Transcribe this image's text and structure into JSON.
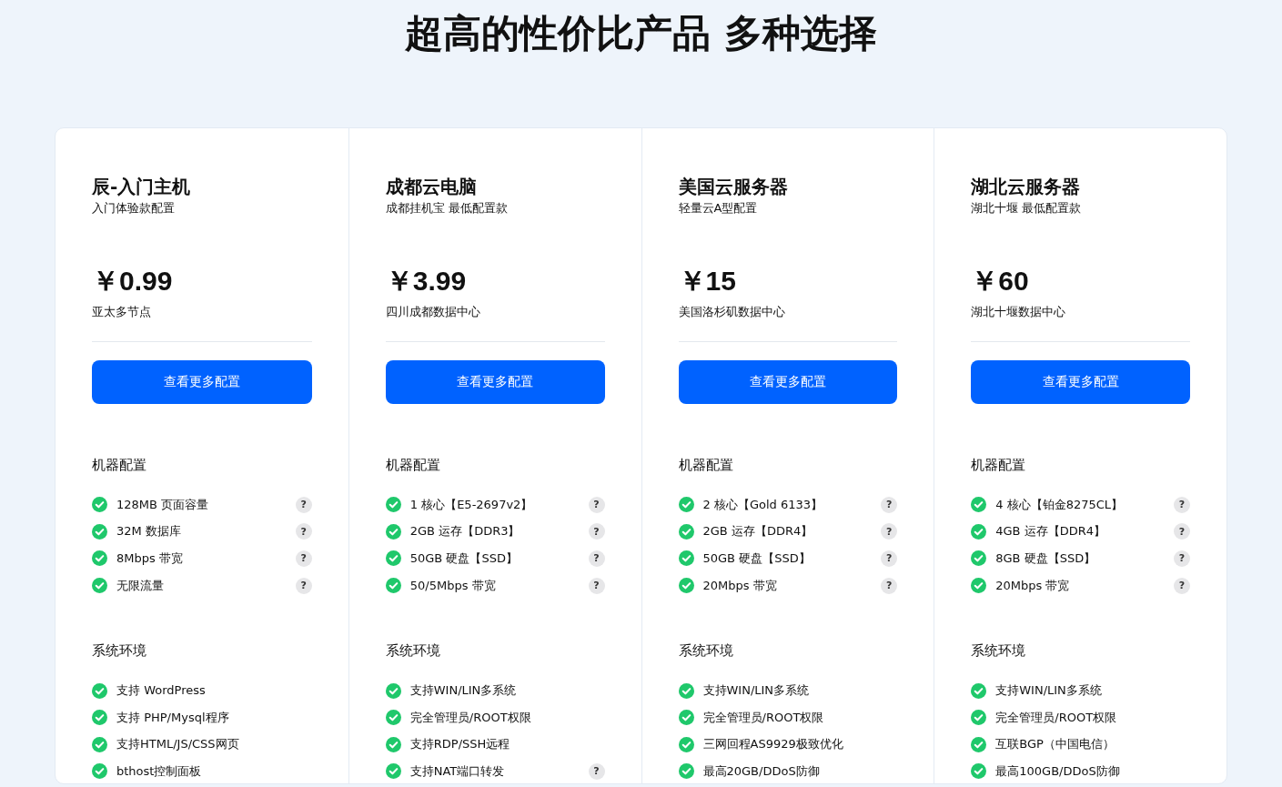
{
  "heading": "超高的性价比产品 多种选择",
  "plans": [
    {
      "name": "辰-入门主机",
      "subtitle": "入门体验款配置",
      "price": "￥0.99",
      "location": "亚太多节点",
      "button": "查看更多配置",
      "sections": [
        {
          "title": "机器配置",
          "items": [
            {
              "text": "128MB 页面容量",
              "help": "?"
            },
            {
              "text": "32M 数据库",
              "help": "?"
            },
            {
              "text": "8Mbps 带宽",
              "help": "?"
            },
            {
              "text": "无限流量",
              "help": "?"
            }
          ]
        },
        {
          "title": "系统环境",
          "items": [
            {
              "text": "支持 WordPress"
            },
            {
              "text": "支持 PHP/Mysql程序"
            },
            {
              "text": "支持HTML/JS/CSS网页"
            },
            {
              "text": "bthost控制面板"
            }
          ]
        }
      ]
    },
    {
      "name": "成都云电脑",
      "subtitle": "成都挂机宝 最低配置款",
      "price": "￥3.99",
      "location": "四川成都数据中心",
      "button": "查看更多配置",
      "sections": [
        {
          "title": "机器配置",
          "items": [
            {
              "text": "1 核心【E5-2697v2】",
              "help": "?"
            },
            {
              "text": "2GB 运存【DDR3】",
              "help": "?"
            },
            {
              "text": "50GB 硬盘【SSD】",
              "help": "?"
            },
            {
              "text": "50/5Mbps 带宽",
              "help": "?"
            }
          ]
        },
        {
          "title": "系统环境",
          "items": [
            {
              "text": "支持WIN/LIN多系统"
            },
            {
              "text": "完全管理员/ROOT权限"
            },
            {
              "text": "支持RDP/SSH远程"
            },
            {
              "text": "支持NAT端口转发",
              "help": "?"
            }
          ]
        }
      ]
    },
    {
      "name": "美国云服务器",
      "subtitle": "轻量云A型配置",
      "price": "￥15",
      "location": "美国洛杉矶数据中心",
      "button": "查看更多配置",
      "sections": [
        {
          "title": "机器配置",
          "items": [
            {
              "text": "2 核心【Gold 6133】",
              "help": "?"
            },
            {
              "text": "2GB 运存【DDR4】",
              "help": "?"
            },
            {
              "text": "50GB 硬盘【SSD】",
              "help": "?"
            },
            {
              "text": "20Mbps 带宽",
              "help": "?"
            }
          ]
        },
        {
          "title": "系统环境",
          "items": [
            {
              "text": "支持WIN/LIN多系统"
            },
            {
              "text": "完全管理员/ROOT权限"
            },
            {
              "text": "三网回程AS9929极致优化"
            },
            {
              "text": "最高20GB/DDoS防御"
            }
          ]
        }
      ]
    },
    {
      "name": "湖北云服务器",
      "subtitle": "湖北十堰 最低配置款",
      "price": "￥60",
      "location": "湖北十堰数据中心",
      "button": "查看更多配置",
      "sections": [
        {
          "title": "机器配置",
          "items": [
            {
              "text": "4 核心【铂金8275CL】",
              "help": "?"
            },
            {
              "text": "4GB 运存【DDR4】",
              "help": "?"
            },
            {
              "text": "8GB 硬盘【SSD】",
              "help": "?"
            },
            {
              "text": "20Mbps 带宽",
              "help": "?"
            }
          ]
        },
        {
          "title": "系统环境",
          "items": [
            {
              "text": "支持WIN/LIN多系统"
            },
            {
              "text": "完全管理员/ROOT权限"
            },
            {
              "text": "互联BGP（中国电信）"
            },
            {
              "text": "最高100GB/DDoS防御"
            }
          ]
        }
      ]
    }
  ]
}
